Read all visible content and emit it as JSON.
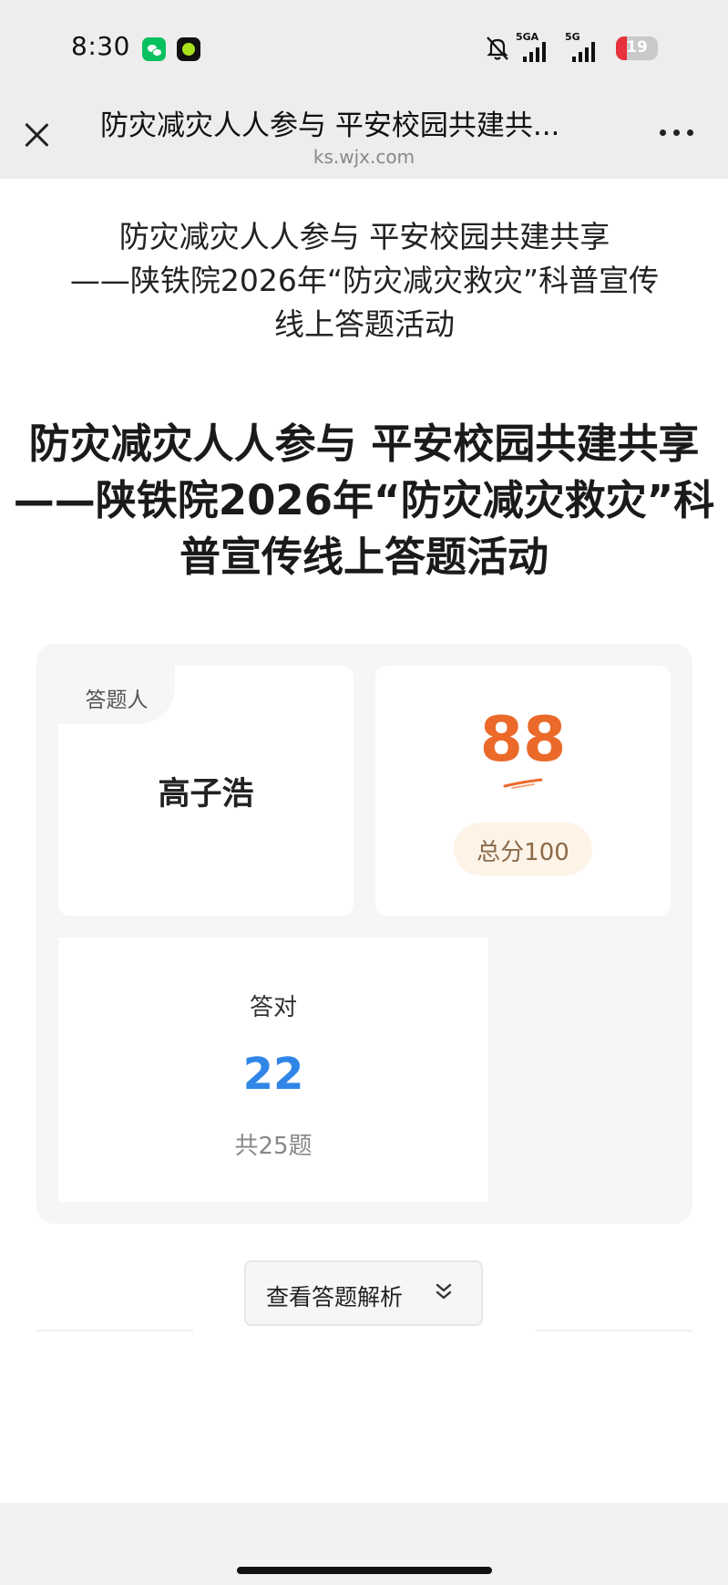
{
  "status_bar": {
    "time": "8:30",
    "signal_1_label": "5GA",
    "signal_2_label": "5G",
    "battery_level": "19",
    "icons": [
      "wechat-icon",
      "app-icon",
      "mute-icon",
      "signal-icon",
      "signal-icon",
      "battery-icon"
    ]
  },
  "nav": {
    "title": "防灾减灾人人参与 平安校园共建共...",
    "url": "ks.wjx.com",
    "close_icon": "close-icon",
    "more_icon": "more-icon"
  },
  "page": {
    "header_title": "防灾减灾人人参与 平安校园共建共享\n——陕铁院2026年“防灾减灾救灾”科普宣传\n线上答题活动",
    "main_title": "防灾减灾人人参与 平安校园共建共享\n——陕铁院2026年“防灾减灾救灾”科\n普宣传线上答题活动"
  },
  "result": {
    "answerer_label": "答题人",
    "answerer_name": "高子浩",
    "score": "88",
    "score_total": "总分100",
    "correct_label": "答对",
    "correct_count": "22",
    "total_questions": "共25题"
  },
  "actions": {
    "view_analysis_label": "查看答题解析"
  },
  "colors": {
    "score": "#eb6a2a",
    "correct": "#2f86e6",
    "panel_bg": "#f5f6f8",
    "battery_low": "#e8313c"
  }
}
